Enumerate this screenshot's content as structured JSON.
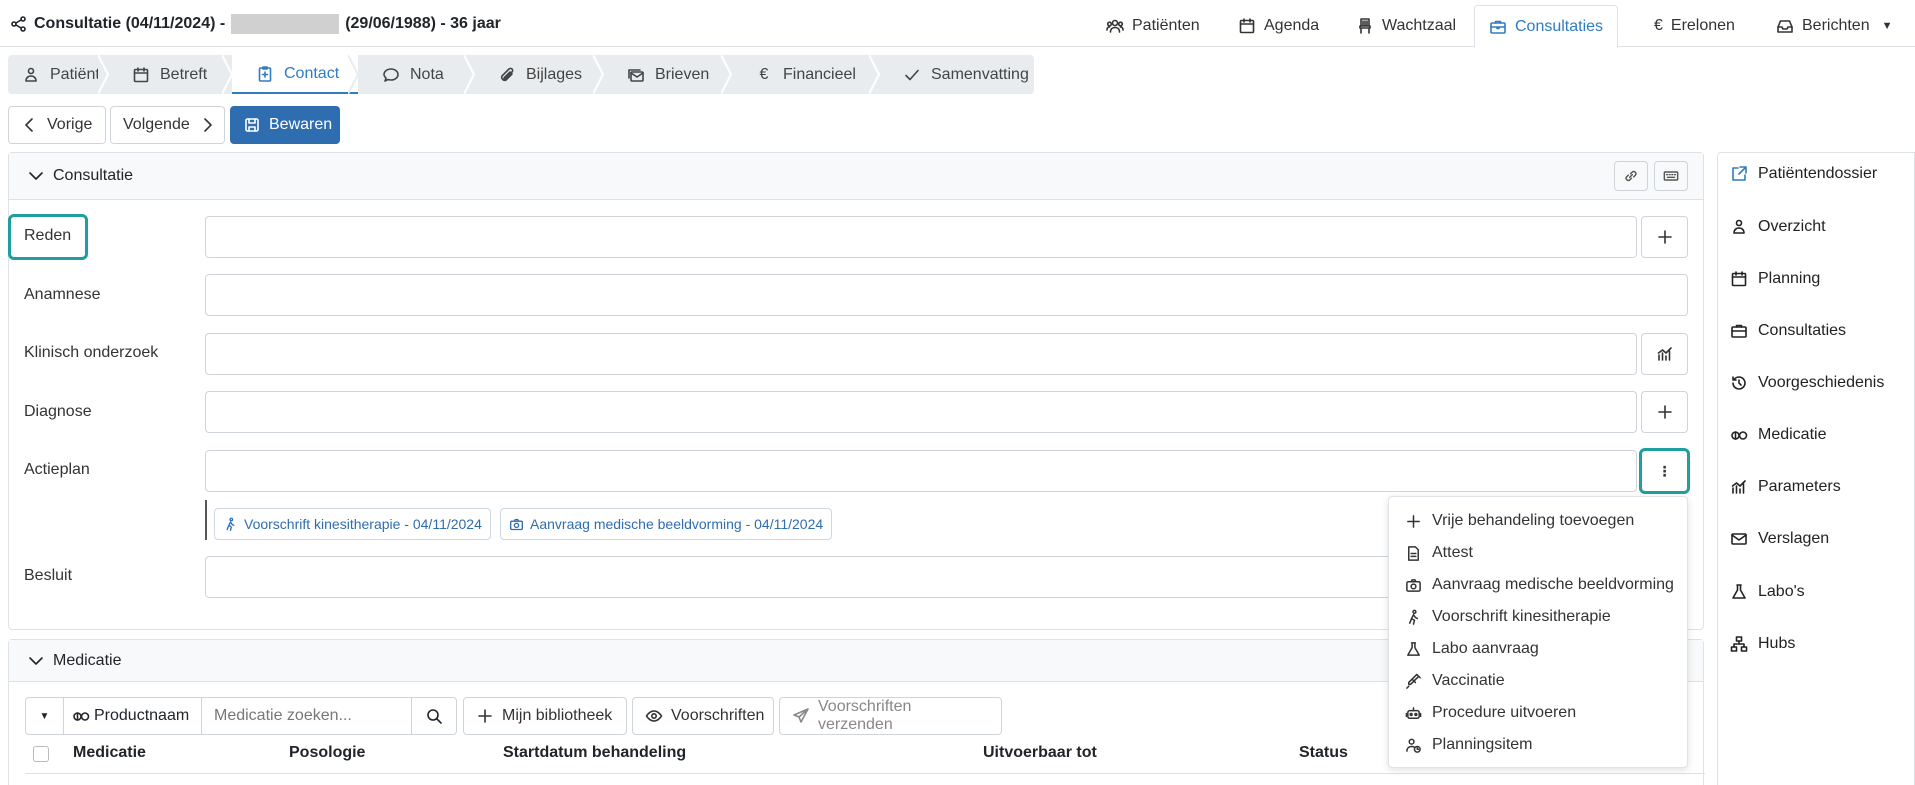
{
  "header": {
    "title_prefix": "Consultatie (04/11/2024) -",
    "title_suffix": "(29/06/1988) - 36 jaar",
    "tabs": [
      {
        "label": "Patiënten",
        "icon": "users-icon"
      },
      {
        "label": "Agenda",
        "icon": "calendar-icon"
      },
      {
        "label": "Wachtzaal",
        "icon": "chair-icon"
      },
      {
        "label": "Consultaties",
        "icon": "briefcase-icon",
        "active": true
      },
      {
        "label": "Erelonen",
        "icon": "euro-icon"
      },
      {
        "label": "Berichten",
        "icon": "inbox-icon"
      }
    ]
  },
  "steps": [
    {
      "label": "Patiënt",
      "icon": "person-icon"
    },
    {
      "label": "Betreft",
      "icon": "calendar-icon"
    },
    {
      "label": "Contact",
      "icon": "clipboard-plus-icon",
      "active": true
    },
    {
      "label": "Nota",
      "icon": "chat-icon"
    },
    {
      "label": "Bijlages",
      "icon": "paperclip-icon"
    },
    {
      "label": "Brieven",
      "icon": "envelopes-icon"
    },
    {
      "label": "Financieel",
      "icon": "euro-icon"
    },
    {
      "label": "Samenvatting",
      "icon": "check-icon"
    }
  ],
  "actions": {
    "prev": "Vorige",
    "next": "Volgende",
    "save": "Bewaren"
  },
  "consultatie": {
    "title": "Consultatie",
    "fields": {
      "reden": "Reden",
      "anamnese": "Anamnese",
      "klinisch": "Klinisch onderzoek",
      "diagnose": "Diagnose",
      "actieplan": "Actieplan",
      "besluit": "Besluit"
    },
    "chips": [
      "Voorschrift kinesitherapie - 04/11/2024",
      "Aanvraag medische beeldvorming - 04/11/2024"
    ]
  },
  "menu": [
    {
      "label": "Vrije behandeling toevoegen",
      "icon": "plus-icon"
    },
    {
      "label": "Attest",
      "icon": "document-icon"
    },
    {
      "label": "Aanvraag medische beeldvorming",
      "icon": "camera-icon"
    },
    {
      "label": "Voorschrift kinesitherapie",
      "icon": "walking-person-icon"
    },
    {
      "label": "Labo aanvraag",
      "icon": "flask-icon"
    },
    {
      "label": "Vaccinatie",
      "icon": "syringe-icon"
    },
    {
      "label": "Procedure uitvoeren",
      "icon": "robot-icon"
    },
    {
      "label": "Planningsitem",
      "icon": "person-clock-icon"
    }
  ],
  "sidebar": [
    {
      "label": "Patiëntendossier",
      "icon": "external-edit-icon"
    },
    {
      "label": "Overzicht",
      "icon": "person-icon"
    },
    {
      "label": "Planning",
      "icon": "calendar-icon"
    },
    {
      "label": "Consultaties",
      "icon": "briefcase-icon"
    },
    {
      "label": "Voorgeschiedenis",
      "icon": "history-icon"
    },
    {
      "label": "Medicatie",
      "icon": "pills-icon"
    },
    {
      "label": "Parameters",
      "icon": "chart-icon"
    },
    {
      "label": "Verslagen",
      "icon": "envelope-icon"
    },
    {
      "label": "Labo's",
      "icon": "flask-icon"
    },
    {
      "label": "Hubs",
      "icon": "hierarchy-icon"
    }
  ],
  "medicatie": {
    "title": "Medicatie",
    "product_filter": "Productnaam",
    "search_placeholder": "Medicatie zoeken...",
    "library": "Mijn bibliotheek",
    "prescriptions": "Voorschriften",
    "send": "Voorschriften verzenden",
    "columns": [
      "Medicatie",
      "Posologie",
      "Startdatum behandeling",
      "Uitvoerbaar tot",
      "Status"
    ]
  },
  "colors": {
    "accent": "#2f7cc2",
    "primary": "#2f6db1",
    "highlight": "#1f9e9e"
  }
}
